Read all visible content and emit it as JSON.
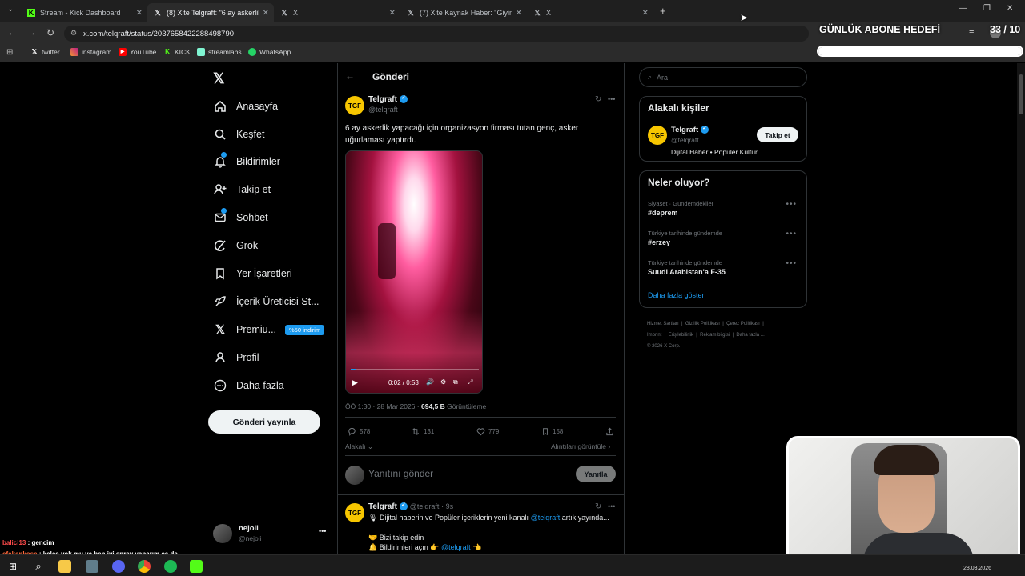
{
  "browser": {
    "tabs": [
      {
        "title": "Stream - Kick Dashboard",
        "icon": "kick-icon",
        "active": false
      },
      {
        "title": "(8) X'te Telgraft: \"6 ay askerlik y",
        "icon": "x-logo-icon",
        "active": true
      },
      {
        "title": "X",
        "icon": "x-logo-icon",
        "active": false
      },
      {
        "title": "(7) X'te Kaynak Haber: \"Giyim tı",
        "icon": "x-logo-icon",
        "active": false
      },
      {
        "title": "X",
        "icon": "x-logo-icon",
        "active": false
      }
    ],
    "url": "x.com/telqraft/status/2037658422288498790",
    "bookmarks": [
      "twitter",
      "instagram",
      "YouTube",
      "KICK",
      "streamlabs",
      "WhatsApp"
    ]
  },
  "sidebar": {
    "items": [
      {
        "label": "Anasayfa",
        "icon": "home-icon"
      },
      {
        "label": "Keşfet",
        "icon": "search-icon"
      },
      {
        "label": "Bildirimler",
        "icon": "bell-icon"
      },
      {
        "label": "Takip et",
        "icon": "person-plus-icon"
      },
      {
        "label": "Sohbet",
        "icon": "mail-icon"
      },
      {
        "label": "Grok",
        "icon": "grok-icon"
      },
      {
        "label": "Yer İşaretleri",
        "icon": "bookmark-icon"
      },
      {
        "label": "İçerik Üreticisi St...",
        "icon": "rocket-icon"
      },
      {
        "label": "Premiu...",
        "icon": "x-logo-icon"
      },
      {
        "label": "Profil",
        "icon": "person-icon"
      },
      {
        "label": "Daha fazla",
        "icon": "more-circle-icon"
      }
    ],
    "premium_badge": "%50 indirim",
    "post_button": "Gönderi yayınla",
    "user": {
      "name": "nejoli",
      "handle": "@nejoli"
    }
  },
  "post": {
    "header": "Gönderi",
    "author": "Telgraft",
    "handle": "@telqraft",
    "text_line1": "6 ay askerlik yapacağı için organizasyon firması tutan genç, asker",
    "text_line2": "uğurlaması yaptırdı.",
    "video_time": "0:02 / 0:53",
    "meta_time": "ÖÖ 1:30 · 28 Mar 2026 ·",
    "views": "694,5 B",
    "views_label": "Görüntüleme",
    "replies": "578",
    "reposts": "131",
    "likes": "779",
    "bookmarks": "158",
    "related_label": "Alakalı",
    "quotes_label": "Alıntıları görüntüle",
    "reply_placeholder": "Yanıtını gönder",
    "reply_button": "Yanıtla"
  },
  "reply_post": {
    "author": "Telgraft",
    "handle": "@telqraft",
    "time": "· 9s",
    "line1_pre": "Dijital haberin ve Popüler içeriklerin yeni kanalı",
    "line1_link": "@telqraft",
    "line1_post": "artık yayında...",
    "line2": "Bizi takip edin",
    "line3_pre": "Bildirimleri açın 👉",
    "line3_link": "@telqraft"
  },
  "right": {
    "search_placeholder": "Ara",
    "related_title": "Alakalı kişiler",
    "related_name": "Telgraft",
    "related_handle": "@telqraft",
    "related_bio": "Dijital Haber • Popüler Kültür",
    "follow_button": "Takip et",
    "trends_title": "Neler oluyor?",
    "trends": [
      {
        "context": "Siyaset · Gündemdekiler",
        "name": "#deprem"
      },
      {
        "context": "Türkiye tarihinde gündemde",
        "name": "#erzey"
      },
      {
        "context": "Türkiye tarihinde gündemde",
        "name": "Suudi Arabistan'a F-35"
      }
    ],
    "show_more": "Daha fazla göster",
    "footer_line1": [
      "Hizmet Şartları",
      "Gizlilik Politikası",
      "Çerez Politikası"
    ],
    "footer_line2": [
      "Imprint",
      "Erişilebilirlik",
      "Reklam bilgisi",
      "Daha fazla ..."
    ],
    "copyright": "© 2026 X Corp."
  },
  "overlay": {
    "goal_label": "GÜNLÜK ABONE HEDEFİ",
    "goal_count": "33 / 10",
    "goal_progress": 1.0
  },
  "chat": [
    {
      "user": "balici13",
      "message": "gencim",
      "color": "#ff4b4b"
    },
    {
      "user": "efekankose",
      "message": "keleş yok mu ya ben iyi sprey yaparım cs de",
      "color": "#ff6a3d"
    }
  ],
  "taskbar": {
    "date": "28.03.2026"
  },
  "colors": {
    "accent": "#1d9bf0",
    "background": "#000000",
    "border": "#2f3336"
  }
}
